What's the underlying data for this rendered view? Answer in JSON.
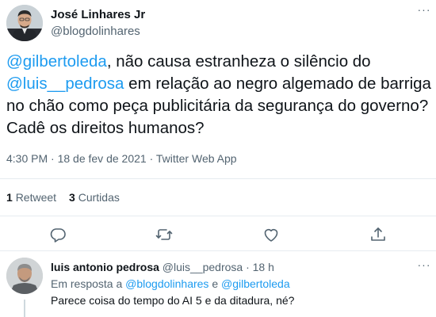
{
  "tweet": {
    "author_name": "José Linhares Jr",
    "author_handle": "@blogdolinhares",
    "more_label": "···",
    "text_parts": {
      "mention1": "@gilbertoleda",
      "seg1": ", não causa estranheza o silêncio do ",
      "mention2": "@luis__pedrosa",
      "seg2": " em relação ao negro algemado de barriga no chão como peça publicitária da segurança do governo? Cadê os direitos humanos?"
    },
    "timestamp": "4:30 PM · 18 de fev de 2021 · Twitter Web App"
  },
  "stats": {
    "retweets_count": "1",
    "retweets_label": "Retweet",
    "likes_count": "3",
    "likes_label": "Curtidas"
  },
  "actions": [
    "reply-icon",
    "retweet-icon",
    "like-icon",
    "share-icon"
  ],
  "reply": {
    "author_name": "luis antonio pedrosa",
    "author_handle": "@luis__pedrosa",
    "time": "· 18 h",
    "replying_prefix": "Em resposta a ",
    "replying_to_1": "@blogdolinhares",
    "replying_and": " e ",
    "replying_to_2": "@gilbertoleda",
    "text": "Parece coisa do tempo do AI 5 e da ditadura, né?",
    "more_label": "···"
  },
  "colors": {
    "accent": "#1d9bf0",
    "text": "#0f1419",
    "secondary": "#536471",
    "divider": "#e6ecf0"
  }
}
